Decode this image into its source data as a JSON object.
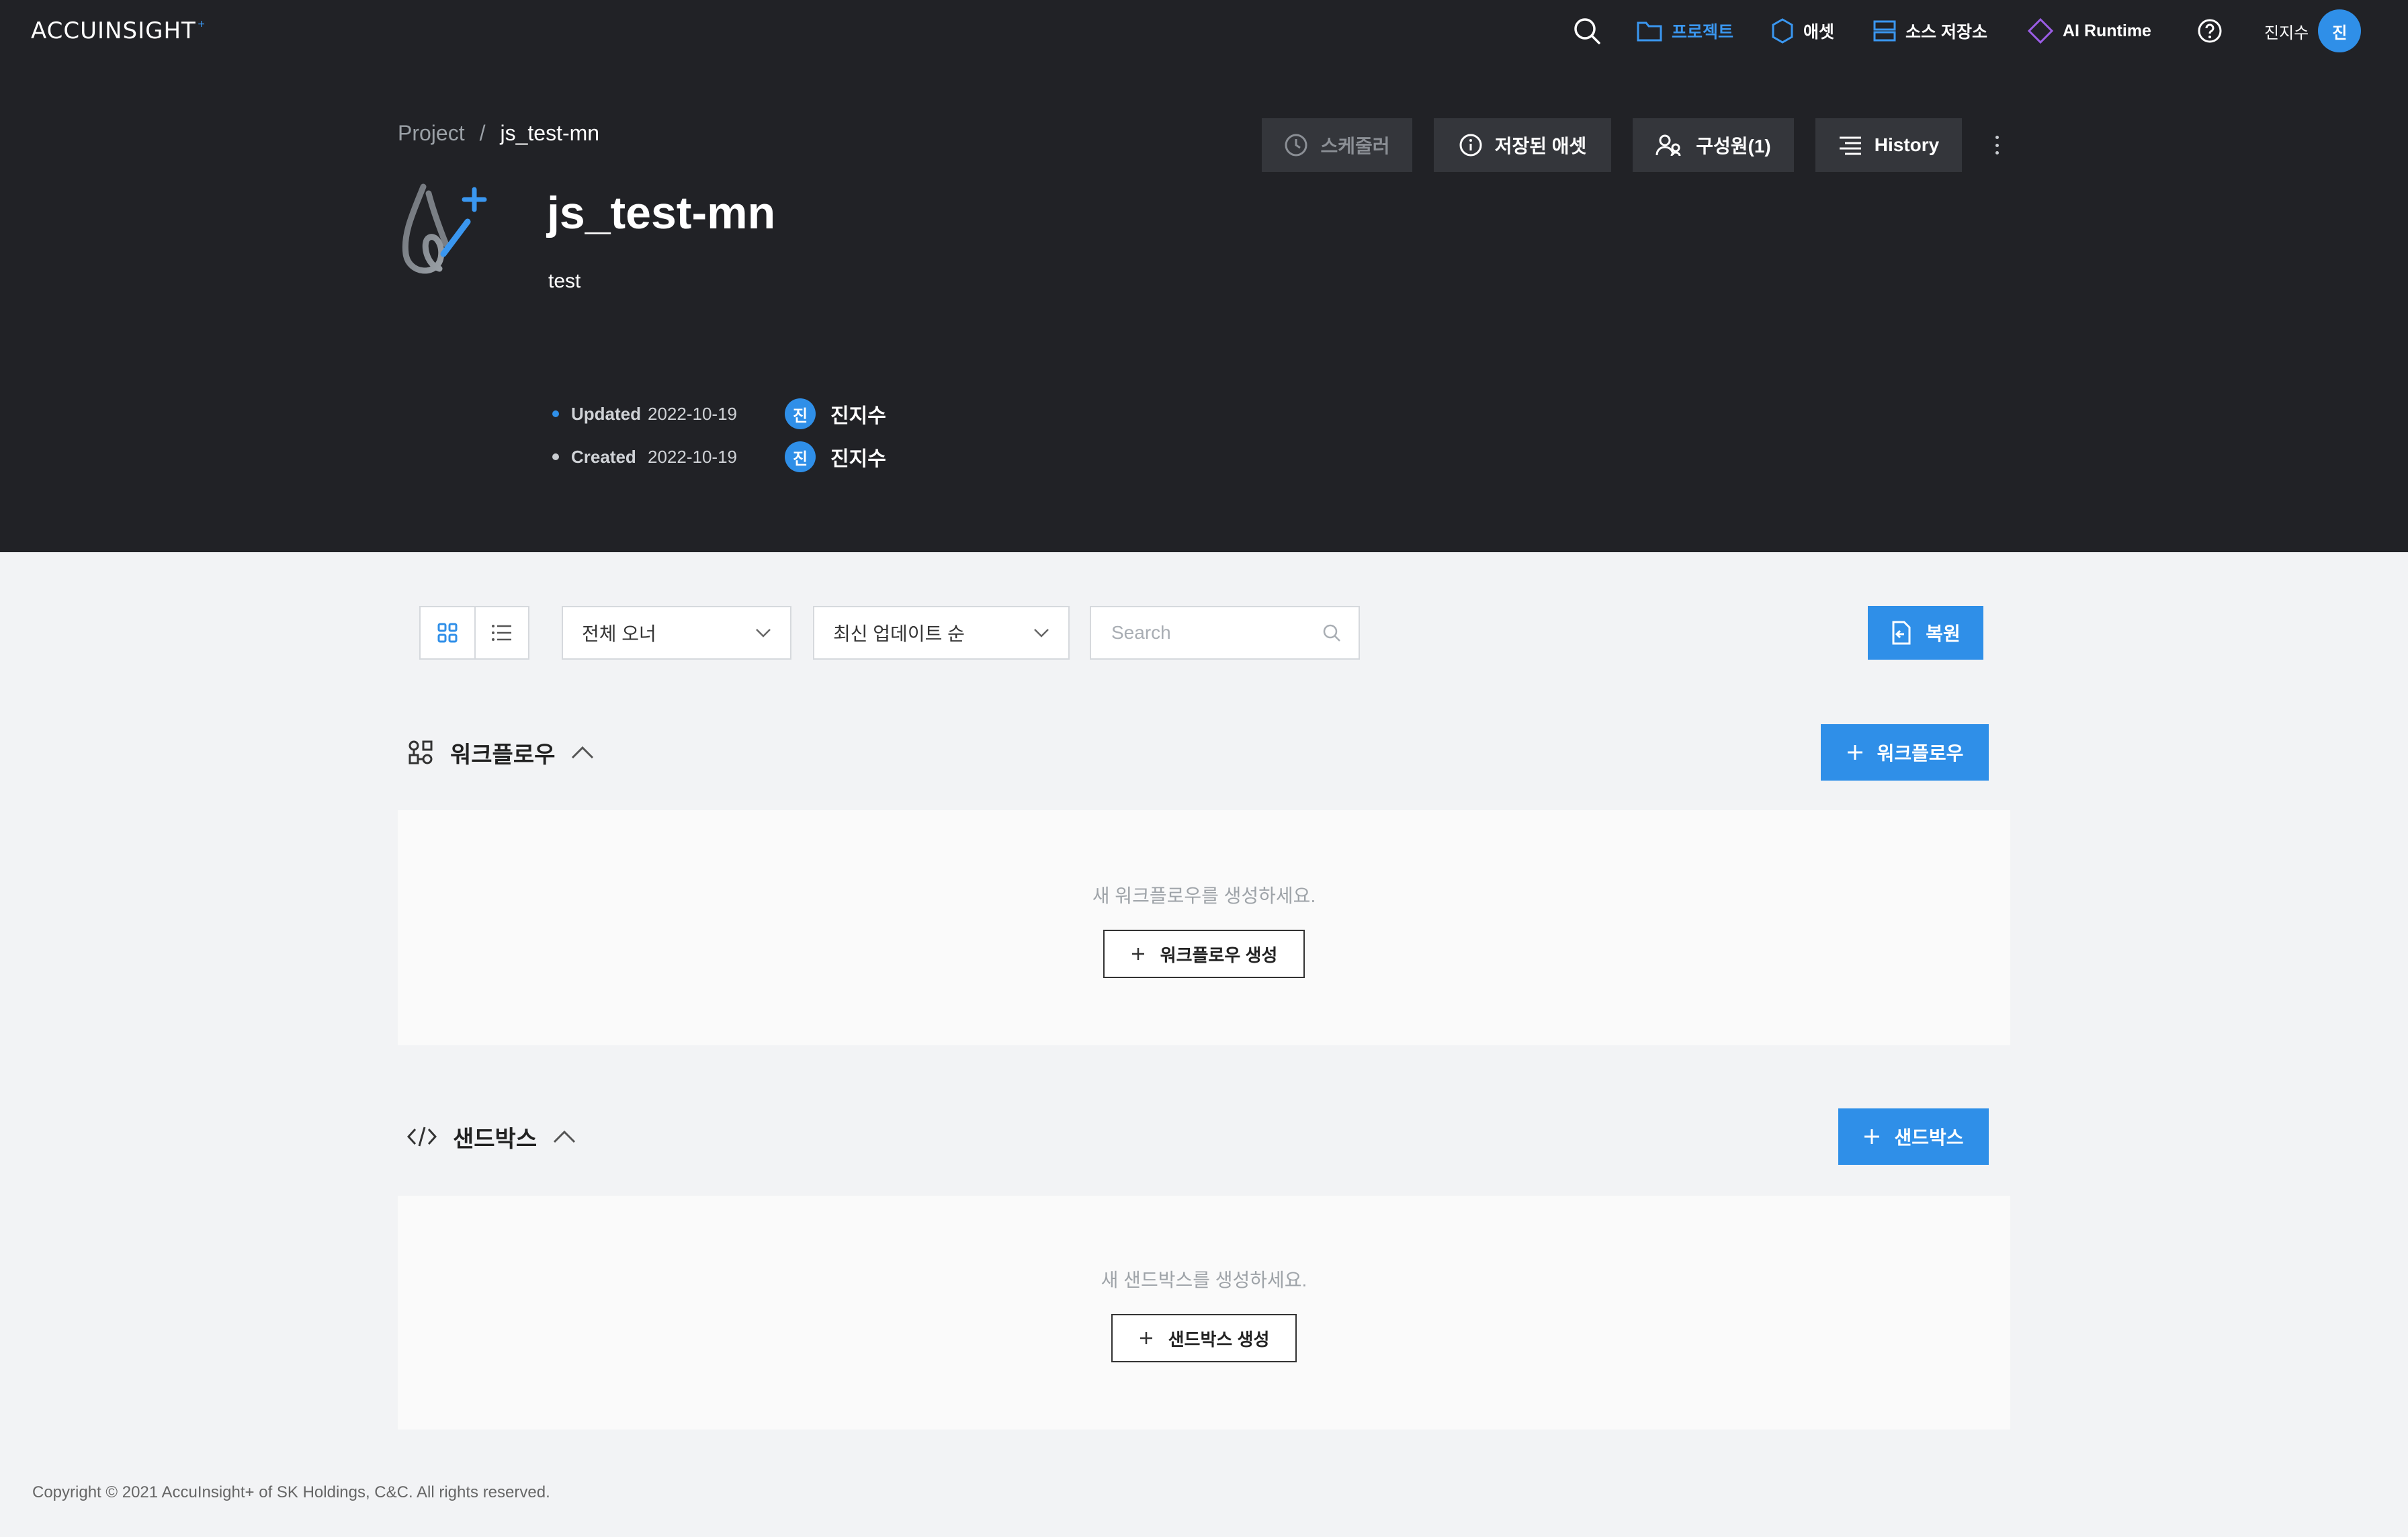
{
  "app": {
    "logo_text": "ACCUINSIGHT",
    "logo_sup": "+"
  },
  "nav": {
    "projects": "프로젝트",
    "assets": "애셋",
    "source_repo": "소스 저장소",
    "ai_runtime": "AI Runtime",
    "user_name": "진지수",
    "user_initial": "진"
  },
  "breadcrumb": {
    "root": "Project",
    "separator": "/",
    "current": "js_test-mn"
  },
  "actions": {
    "scheduler": "스케줄러",
    "saved_assets": "저장된 애셋",
    "members": "구성원(1)",
    "history": "History"
  },
  "project": {
    "title": "js_test-mn",
    "description": "test",
    "updated_label": "Updated",
    "updated_date": "2022-10-19",
    "updated_by": "진지수",
    "updated_by_initial": "진",
    "created_label": "Created",
    "created_date": "2022-10-19",
    "created_by": "진지수",
    "created_by_initial": "진"
  },
  "toolbar": {
    "owner_filter": "전체 오너",
    "sort": "최신 업데이트 순",
    "search_placeholder": "Search",
    "restore": "복원"
  },
  "workflow": {
    "title": "워크플로우",
    "add_button": "워크플로우",
    "empty_message": "새 워크플로우를 생성하세요.",
    "create_button": "워크플로우 생성"
  },
  "sandbox": {
    "title": "샌드박스",
    "add_button": "샌드박스",
    "empty_message": "새 샌드박스를 생성하세요.",
    "create_button": "샌드박스 생성"
  },
  "footer": {
    "copyright": "Copyright © 2021 AccuInsight+ of SK Holdings, C&C. All rights reserved."
  },
  "colors": {
    "header_bg": "#212226",
    "accent": "#2f8fe8",
    "page_bg": "#f2f3f5"
  }
}
